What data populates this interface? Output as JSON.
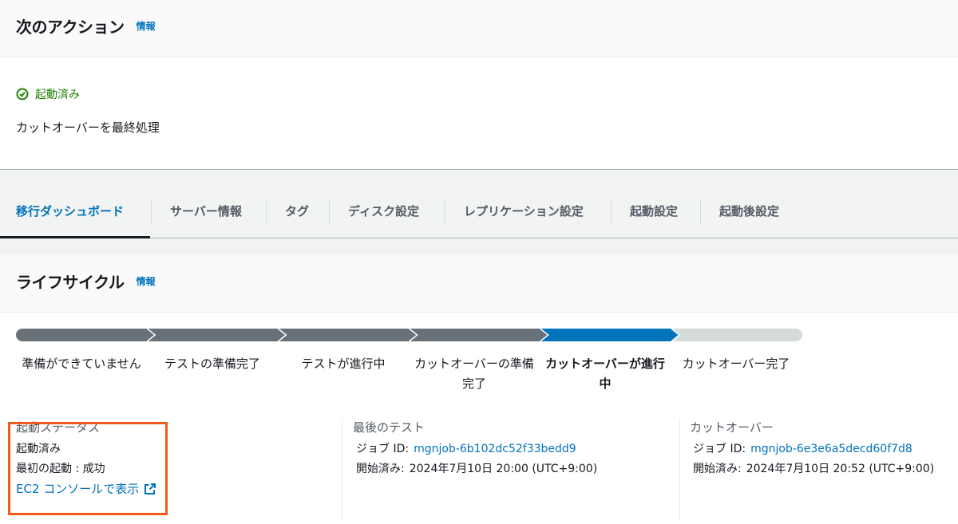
{
  "next_action": {
    "title": "次のアクション",
    "info": "情報",
    "status": "起動済み",
    "action": "カットオーバーを最終処理"
  },
  "tabs": [
    {
      "label": "移行ダッシュボード",
      "active": true
    },
    {
      "label": "サーバー情報"
    },
    {
      "label": "タグ"
    },
    {
      "label": "ディスク設定"
    },
    {
      "label": "レプリケーション設定"
    },
    {
      "label": "起動設定"
    },
    {
      "label": "起動後設定"
    }
  ],
  "lifecycle": {
    "title": "ライフサイクル",
    "info": "情報",
    "stages": [
      {
        "label": "準備ができていません",
        "state": "done"
      },
      {
        "label": "テストの準備完了",
        "state": "done"
      },
      {
        "label": "テストが進行中",
        "state": "done"
      },
      {
        "label": "カットオーバーの準備完了",
        "state": "done"
      },
      {
        "label": "カットオーバーが進行中",
        "state": "current"
      },
      {
        "label": "カットオーバー完了",
        "state": "pending"
      }
    ],
    "colors": {
      "done": "#687078",
      "current": "#0073bb",
      "pending": "#d5dbdb"
    }
  },
  "launch_status": {
    "title": "起動ステータス",
    "value": "起動済み",
    "first_launch": "最初の起動 : 成功",
    "ec2_link": "EC2 コンソールで表示"
  },
  "last_test": {
    "title": "最後のテスト",
    "job_label": "ジョブ ID:",
    "job_id": "mgnjob-6b102dc52f33bedd9",
    "started_label": "開始済み:",
    "started": "2024年7月10日 20:00 (UTC+9:00)"
  },
  "cutover": {
    "title": "カットオーバー",
    "job_label": "ジョブ ID:",
    "job_id": "mgnjob-6e3e6a5decd60f7d8",
    "started_label": "開始済み:",
    "started": "2024年7月10日 20:52 (UTC+9:00)"
  }
}
